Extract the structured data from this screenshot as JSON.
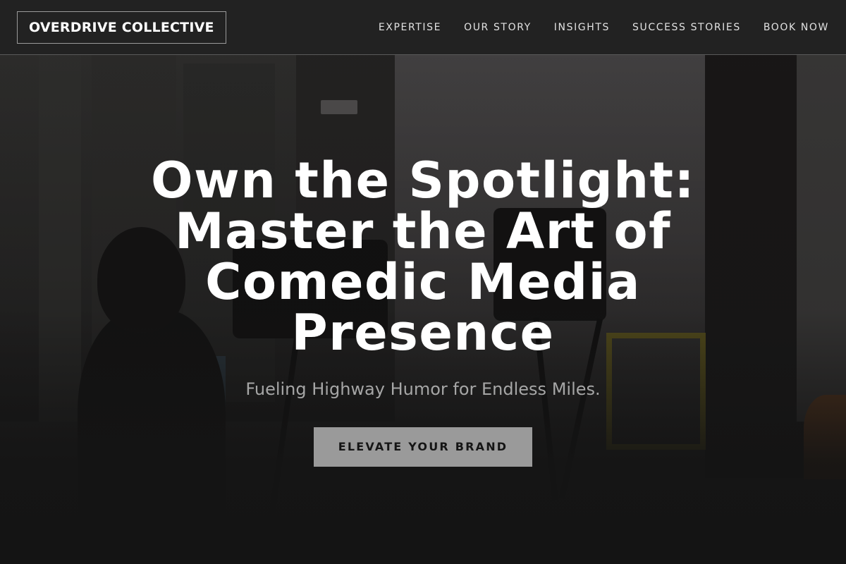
{
  "header": {
    "logo_text": "OVERDRIVE COLLECTIVE",
    "nav": [
      {
        "label": "EXPERTISE"
      },
      {
        "label": "OUR STORY"
      },
      {
        "label": "INSIGHTS"
      },
      {
        "label": "SUCCESS STORIES"
      },
      {
        "label": "BOOK NOW"
      }
    ]
  },
  "hero": {
    "title": "Own the Spotlight: Master the Art of Comedic Media Presence",
    "subtitle": "Fueling Highway Humor for Endless Miles.",
    "cta_label": "ELEVATE YOUR BRAND"
  },
  "colors": {
    "header_bg": "#222222",
    "page_bg": "#151515",
    "cta_bg": "#9a9a9a",
    "title_color": "#ffffff",
    "subtitle_color": "#a6a6a6"
  }
}
